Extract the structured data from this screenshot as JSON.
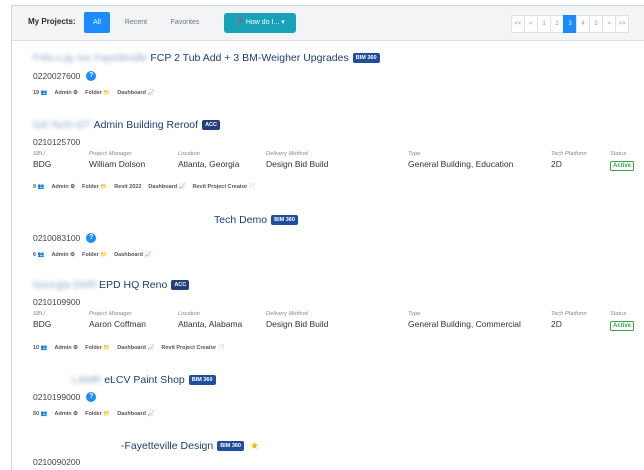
{
  "toolbar": {
    "label": "My Projects:",
    "tabs": [
      "All",
      "Recent",
      "Favorites"
    ],
    "howdo": "❓ How do I...  ▾",
    "pager": [
      "<<",
      "<",
      "1",
      "2",
      "3",
      "4",
      "5",
      ">",
      ">>"
    ]
  },
  "detail_labels": {
    "sbu": "SBU",
    "pm": "Project Manager",
    "loc": "Location",
    "delivery": "Delivery Method",
    "type": "Type",
    "platform": "Tech Platform",
    "status": "Status"
  },
  "projects": [
    {
      "redacted": "Frito-Lay Inc Fayetteville",
      "name": "FCP 2 Tub Add + 3 BM-Weigher Upgrades",
      "badge": "BIM 360",
      "number": "0220027600",
      "links": [
        "19 👥",
        "Admin ⚙",
        "Folder 📁",
        "Dashboard 📈"
      ]
    },
    {
      "redacted": "GA Tech-GT",
      "name": "Admin Building Reroof",
      "badge": "ACC",
      "number": "0210125700",
      "sbu": "BDG",
      "pm": "William Dolson",
      "loc": "Atlanta, Georgia",
      "delivery": "Design Bid Build",
      "type": "General Building, Education",
      "platform": "2D",
      "status": "Active",
      "links": [
        "9 👥",
        "Admin ⚙",
        "Folder 📁",
        "Revit 2022",
        "Dashboard 📈",
        "Revit Project Creator 📄"
      ]
    },
    {
      "name": "Tech Demo",
      "badge": "BIM 360",
      "number": "0210083100",
      "links": [
        "6 👥",
        "Admin ⚙",
        "Folder 📁",
        "Dashboard 📈"
      ]
    },
    {
      "redacted": "Georgia DNR",
      "name": "EPD HQ Reno",
      "badge": "ACC",
      "number": "0210109900",
      "sbu": "BDG",
      "pm": "Aaron Coffman",
      "loc": "Atlanta, Alabama",
      "delivery": "Design Bid Build",
      "type": "General Building, Commercial",
      "platform": "2D",
      "status": "Active",
      "links": [
        "10 👥",
        "Admin ⚙",
        "Folder 📁",
        "Dashboard 📈",
        "Revit Project Creator 📄"
      ]
    },
    {
      "redacted": "LAMR",
      "name": "eLCV Paint Shop",
      "badge": "BIM 360",
      "number": "0210199000",
      "links": [
        "50 👥",
        "Admin ⚙",
        "Folder 📁",
        "Dashboard 📈"
      ]
    },
    {
      "name": "-Fayetteville Design",
      "badge": "BIM 360",
      "number": "0210090200"
    }
  ],
  "colors": {
    "accent": "#1a8cff",
    "title": "#1b3f73",
    "badge": "#1f4e9c",
    "active": "#39a84b",
    "help": "#17a2b8"
  }
}
